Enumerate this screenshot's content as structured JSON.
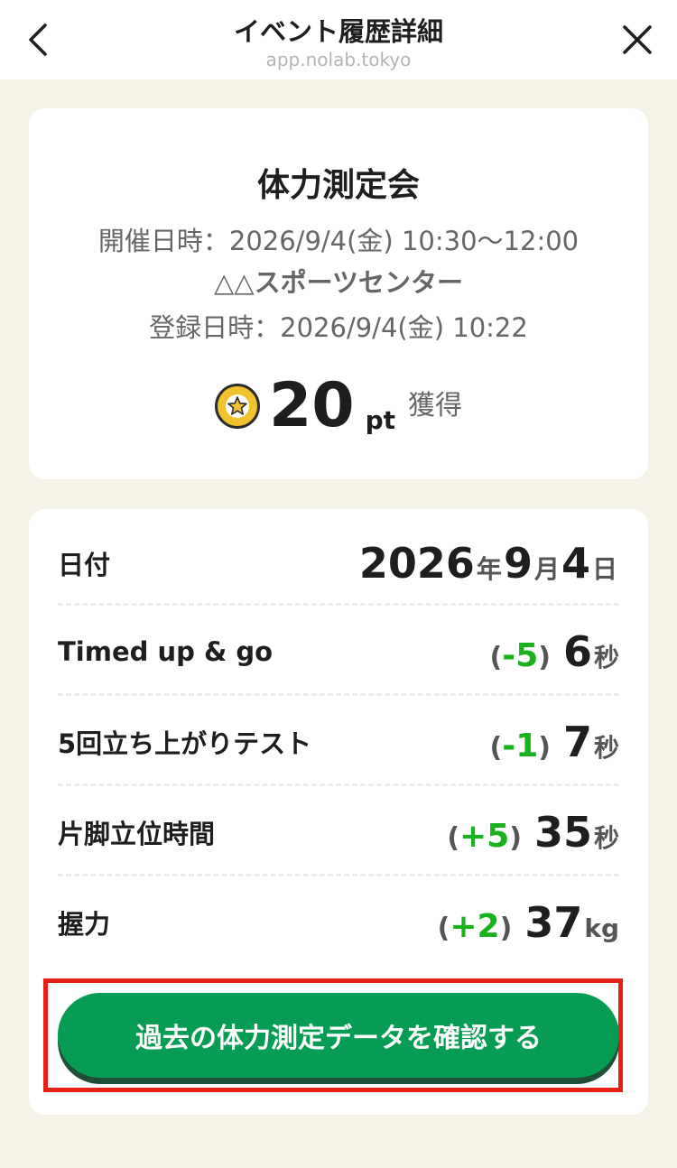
{
  "header": {
    "title": "イベント履歴詳細",
    "url": "app.nolab.tokyo",
    "back_icon": "chevron-left-icon",
    "close_icon": "close-icon"
  },
  "event": {
    "title": "体力測定会",
    "date_line": "開催日時：2026/9/4(金) 10:30〜12:00",
    "venue": "△△スポーツセンター",
    "registered_line": "登録日時：2026/9/4(金) 10:22",
    "points": "20",
    "points_unit": "pt",
    "points_suffix": "獲得",
    "coin_icon": "star-coin-icon"
  },
  "results": {
    "date_label": "日付",
    "date": {
      "year": "2026",
      "year_unit": "年",
      "month": "9",
      "month_unit": "月",
      "day": "4",
      "day_unit": "日"
    },
    "rows": [
      {
        "label": "Timed up & go",
        "delta_open": "(",
        "delta": "-5",
        "delta_close": ")",
        "value": "6",
        "unit": "秒"
      },
      {
        "label": "5回立ち上がりテスト",
        "delta_open": "(",
        "delta": "-1",
        "delta_close": ")",
        "value": "7",
        "unit": "秒"
      },
      {
        "label": "片脚立位時間",
        "delta_open": "(",
        "delta": "+5",
        "delta_close": ")",
        "value": "35",
        "unit": "秒"
      },
      {
        "label": "握力",
        "delta_open": "(",
        "delta": "+2",
        "delta_close": ")",
        "value": "37",
        "unit": "kg"
      }
    ],
    "cta_label": "過去の体力測定データを確認する"
  },
  "colors": {
    "background": "#f5f2e8",
    "accent_green": "#079c53",
    "delta_green": "#17b21c",
    "highlight_red": "#e52113"
  }
}
